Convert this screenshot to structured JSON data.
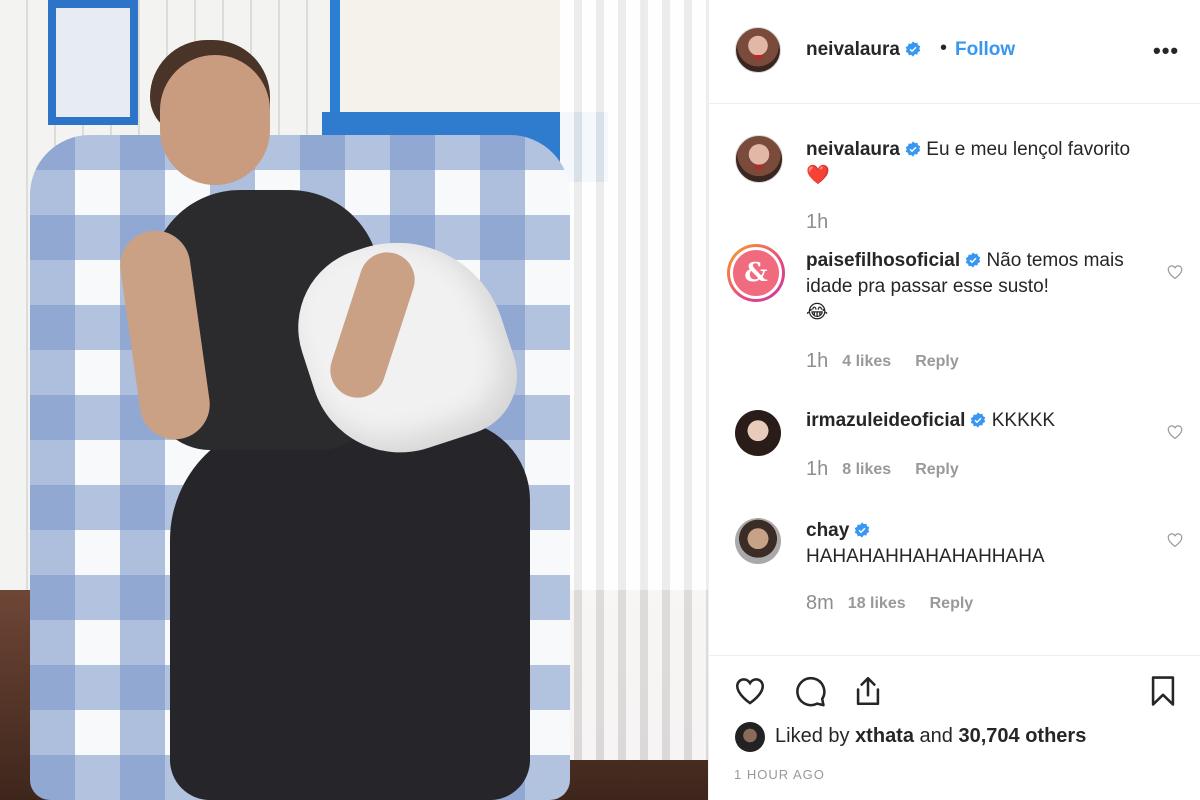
{
  "post": {
    "author": "neivalaura",
    "follow_label": "Follow",
    "separator": "•",
    "more_label": "•••",
    "caption": "Eu e meu lençol favorito",
    "caption_emoji": "❤️",
    "caption_time": "1h"
  },
  "comments": [
    {
      "user": "paisefilhosoficial",
      "avatar_text": "&",
      "text": "Não temos mais idade pra passar esse susto!",
      "emoji": "😂",
      "time": "1h",
      "likes": "4 likes",
      "reply": "Reply"
    },
    {
      "user": "irmazuleideoficial",
      "text": "KKKKK",
      "time": "1h",
      "likes": "8 likes",
      "reply": "Reply"
    },
    {
      "user": "chay",
      "text": "HAHAHAHHAHAHAHHAHA",
      "time": "8m",
      "likes": "18 likes",
      "reply": "Reply"
    }
  ],
  "footer": {
    "liked_prefix": "Liked by",
    "liked_user": "xthata",
    "liked_and": "and",
    "liked_count": "30,704 others",
    "posted": "1 HOUR AGO"
  },
  "colors": {
    "accent": "#3897f0",
    "verified": "#3897f0",
    "muted": "#999999",
    "text": "#262626"
  },
  "icons": [
    "verified-badge-icon",
    "more-options-icon",
    "heart-icon",
    "comment-icon",
    "share-icon",
    "bookmark-icon"
  ]
}
